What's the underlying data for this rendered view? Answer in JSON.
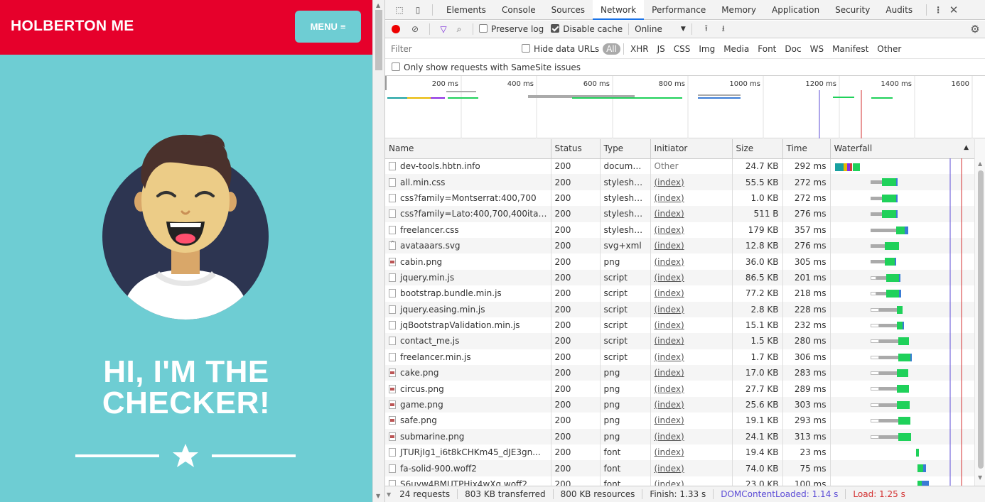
{
  "site": {
    "brand": "HOLBERTON ME",
    "menu_label": "MENU",
    "hero_line1": "HI, I'M THE",
    "hero_line2": "CHECKER!",
    "colors": {
      "nav": "#e6002b",
      "hero": "#6ecdd3"
    }
  },
  "devtools": {
    "tabs": [
      "Elements",
      "Console",
      "Sources",
      "Network",
      "Performance",
      "Memory",
      "Application",
      "Security",
      "Audits"
    ],
    "active_tab": "Network",
    "toolbar": {
      "preserve_log": "Preserve log",
      "disable_cache": "Disable cache",
      "throttle": "Online"
    },
    "filter": {
      "placeholder": "Filter",
      "hide_data_urls": "Hide data URLs",
      "types": [
        "All",
        "XHR",
        "JS",
        "CSS",
        "Img",
        "Media",
        "Font",
        "Doc",
        "WS",
        "Manifest",
        "Other"
      ],
      "active_type": "All",
      "samesite": "Only show requests with SameSite issues"
    },
    "overview_ticks": [
      "200 ms",
      "400 ms",
      "600 ms",
      "800 ms",
      "1000 ms",
      "1200 ms",
      "1400 ms",
      "1600"
    ],
    "columns": [
      "Name",
      "Status",
      "Type",
      "Initiator",
      "Size",
      "Time",
      "Waterfall"
    ],
    "requests": [
      {
        "name": "dev-tools.hbtn.info",
        "status": "200",
        "type": "document",
        "initiator": "Other",
        "size": "24.7 KB",
        "time": "292 ms",
        "icon": "doc"
      },
      {
        "name": "all.min.css",
        "status": "200",
        "type": "stylesheet",
        "initiator": "(index)",
        "size": "55.5 KB",
        "time": "272 ms",
        "icon": "doc"
      },
      {
        "name": "css?family=Montserrat:400,700",
        "status": "200",
        "type": "stylesheet",
        "initiator": "(index)",
        "size": "1.0 KB",
        "time": "272 ms",
        "icon": "doc"
      },
      {
        "name": "css?family=Lato:400,700,400itali...",
        "status": "200",
        "type": "stylesheet",
        "initiator": "(index)",
        "size": "511 B",
        "time": "276 ms",
        "icon": "doc"
      },
      {
        "name": "freelancer.css",
        "status": "200",
        "type": "stylesheet",
        "initiator": "(index)",
        "size": "179 KB",
        "time": "357 ms",
        "icon": "doc"
      },
      {
        "name": "avataaars.svg",
        "status": "200",
        "type": "svg+xml",
        "initiator": "(index)",
        "size": "12.8 KB",
        "time": "276 ms",
        "icon": "svg"
      },
      {
        "name": "cabin.png",
        "status": "200",
        "type": "png",
        "initiator": "(index)",
        "size": "36.0 KB",
        "time": "305 ms",
        "icon": "img"
      },
      {
        "name": "jquery.min.js",
        "status": "200",
        "type": "script",
        "initiator": "(index)",
        "size": "86.5 KB",
        "time": "201 ms",
        "icon": "doc"
      },
      {
        "name": "bootstrap.bundle.min.js",
        "status": "200",
        "type": "script",
        "initiator": "(index)",
        "size": "77.2 KB",
        "time": "218 ms",
        "icon": "doc"
      },
      {
        "name": "jquery.easing.min.js",
        "status": "200",
        "type": "script",
        "initiator": "(index)",
        "size": "2.8 KB",
        "time": "228 ms",
        "icon": "doc"
      },
      {
        "name": "jqBootstrapValidation.min.js",
        "status": "200",
        "type": "script",
        "initiator": "(index)",
        "size": "15.1 KB",
        "time": "232 ms",
        "icon": "doc"
      },
      {
        "name": "contact_me.js",
        "status": "200",
        "type": "script",
        "initiator": "(index)",
        "size": "1.5 KB",
        "time": "280 ms",
        "icon": "doc"
      },
      {
        "name": "freelancer.min.js",
        "status": "200",
        "type": "script",
        "initiator": "(index)",
        "size": "1.7 KB",
        "time": "306 ms",
        "icon": "doc"
      },
      {
        "name": "cake.png",
        "status": "200",
        "type": "png",
        "initiator": "(index)",
        "size": "17.0 KB",
        "time": "283 ms",
        "icon": "img"
      },
      {
        "name": "circus.png",
        "status": "200",
        "type": "png",
        "initiator": "(index)",
        "size": "27.7 KB",
        "time": "289 ms",
        "icon": "img"
      },
      {
        "name": "game.png",
        "status": "200",
        "type": "png",
        "initiator": "(index)",
        "size": "25.6 KB",
        "time": "303 ms",
        "icon": "img"
      },
      {
        "name": "safe.png",
        "status": "200",
        "type": "png",
        "initiator": "(index)",
        "size": "19.1 KB",
        "time": "293 ms",
        "icon": "img"
      },
      {
        "name": "submarine.png",
        "status": "200",
        "type": "png",
        "initiator": "(index)",
        "size": "24.1 KB",
        "time": "313 ms",
        "icon": "img"
      },
      {
        "name": "JTURjIg1_i6t8kCHKm45_dJE3gn...",
        "status": "200",
        "type": "font",
        "initiator": "(index)",
        "size": "19.4 KB",
        "time": "23 ms",
        "icon": "doc"
      },
      {
        "name": "fa-solid-900.woff2",
        "status": "200",
        "type": "font",
        "initiator": "(index)",
        "size": "74.0 KB",
        "time": "75 ms",
        "icon": "doc"
      },
      {
        "name": "S6uyw4BMUTPHjx4wXg.woff2",
        "status": "200",
        "type": "font",
        "initiator": "(index)",
        "size": "23.0 KB",
        "time": "100 ms",
        "icon": "doc"
      }
    ],
    "status_bar": {
      "requests": "24 requests",
      "transferred": "803 KB transferred",
      "resources": "800 KB resources",
      "finish": "Finish: 1.33 s",
      "dcl": "DOMContentLoaded: 1.14 s",
      "load": "Load: 1.25 s"
    },
    "colors": {
      "dcl": "#5b4bd6",
      "load": "#d32f2f",
      "receiving": "#1fd15a",
      "waiting": "#aaaaaa"
    }
  }
}
